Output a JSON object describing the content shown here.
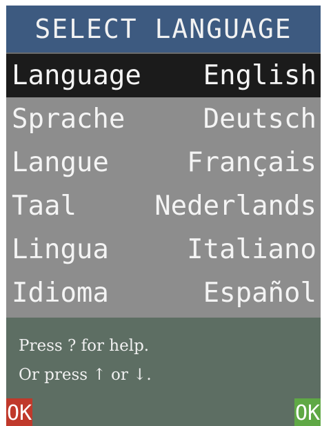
{
  "header": {
    "title": "SELECT LANGUAGE"
  },
  "menu": {
    "items": [
      {
        "label": "Language",
        "value": "English",
        "selected": true
      },
      {
        "label": "Sprache",
        "value": "Deutsch",
        "selected": false
      },
      {
        "label": "Langue",
        "value": "Français",
        "selected": false
      },
      {
        "label": "Taal",
        "value": "Nederlands",
        "selected": false
      },
      {
        "label": "Lingua",
        "value": "Italiano",
        "selected": false
      },
      {
        "label": "Idioma",
        "value": "Español",
        "selected": false
      }
    ]
  },
  "footer": {
    "help_line1": "Press ? for help.",
    "help_line2": "Or press ↑ or ↓.",
    "left_softkey": "OK",
    "right_softkey": "OK"
  },
  "colors": {
    "header_bg": "#3d5a80",
    "selected_row_bg": "#1b1b1b",
    "menu_bg": "#8d8d8d",
    "footer_bg": "#5d6e63",
    "left_softkey_bg": "#c0392b",
    "right_softkey_bg": "#5fa845"
  }
}
